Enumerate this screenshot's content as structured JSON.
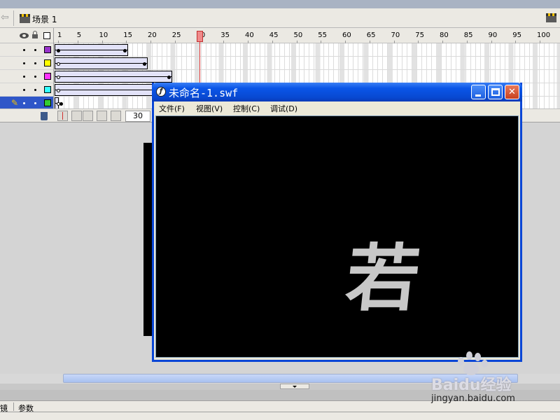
{
  "scene": {
    "label": "场景 1"
  },
  "timeline": {
    "ruler_labels": [
      "1",
      "5",
      "10",
      "15",
      "20",
      "25",
      "30",
      "35",
      "40",
      "45",
      "50",
      "55",
      "60",
      "65",
      "70",
      "75",
      "80",
      "85",
      "90",
      "95",
      "100"
    ],
    "current_frame": "30",
    "layers": [
      {
        "color": "#9933cc",
        "active": false
      },
      {
        "color": "#ffff00",
        "active": false
      },
      {
        "color": "#ff33ff",
        "active": false
      },
      {
        "color": "#33ffff",
        "active": false
      },
      {
        "color": "#33cc33",
        "active": true
      }
    ]
  },
  "swf_window": {
    "title": "未命名-1.swf",
    "menu": [
      "文件(F)",
      "视图(V)",
      "控制(C)",
      "调试(D)"
    ],
    "canvas_glyph": "若"
  },
  "panel_tabs": [
    "镜",
    "参数"
  ],
  "watermark": {
    "brand": "Baidu经验",
    "url": "jingyan.baidu.com"
  },
  "colors": {
    "swf_titlebar": "#0a56e8",
    "swf_canvas": "#000000",
    "playhead": "#e23a3a"
  }
}
